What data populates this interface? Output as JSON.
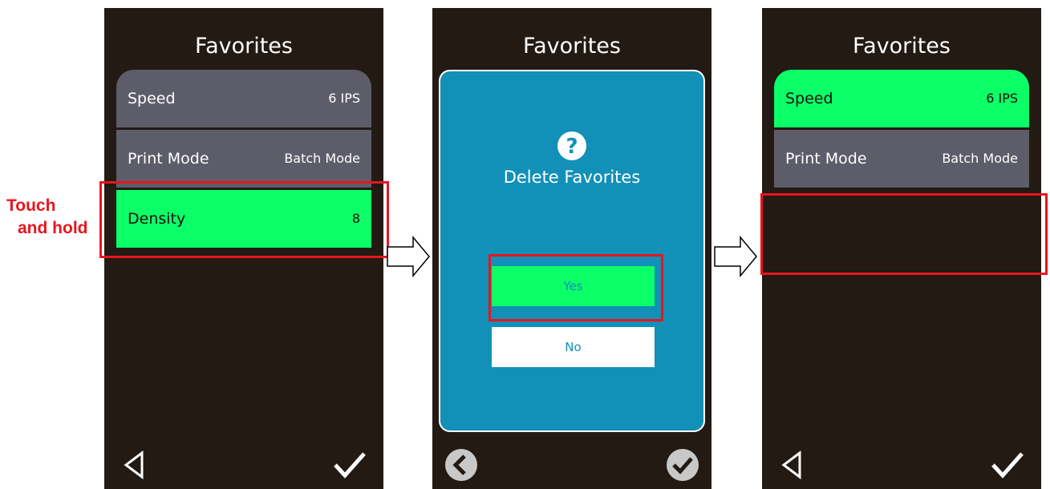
{
  "annotation": {
    "line1": "Touch",
    "line2": "and hold"
  },
  "colors": {
    "screen_bg": "#231a13",
    "row_gray": "#5d5d6a",
    "highlight_green": "#0bff66",
    "dialog_blue": "#1290b8",
    "annotation_red": "#e8151d"
  },
  "screen1": {
    "title": "Favorites",
    "rows": [
      {
        "label": "Speed",
        "value": "6 IPS"
      },
      {
        "label": "Print Mode",
        "value": "Batch Mode"
      },
      {
        "label": "Density",
        "value": "8"
      }
    ],
    "icons": {
      "back": "back-triangle-icon",
      "confirm": "checkmark-icon"
    }
  },
  "screen2": {
    "title": "Favorites",
    "dialog": {
      "icon": "question-icon",
      "title": "Delete Favorites",
      "yes_label": "Yes",
      "no_label": "No"
    },
    "icons": {
      "back": "back-circle-icon",
      "confirm": "check-circle-icon"
    }
  },
  "screen3": {
    "title": "Favorites",
    "rows": [
      {
        "label": "Speed",
        "value": "6 IPS"
      },
      {
        "label": "Print Mode",
        "value": "Batch Mode"
      }
    ],
    "icons": {
      "back": "back-triangle-icon",
      "confirm": "checkmark-icon"
    }
  }
}
